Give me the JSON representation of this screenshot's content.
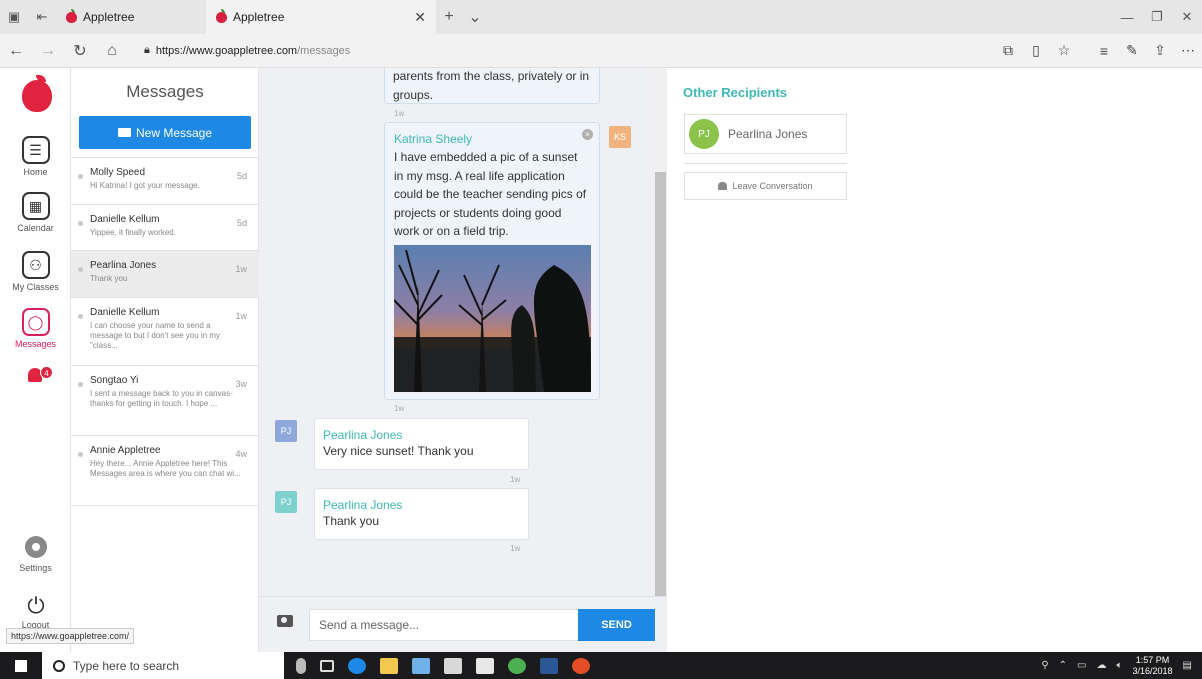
{
  "browser": {
    "tab1_title": "Appletree",
    "tab2_title": "Appletree",
    "url_host": "https://www.goappletree.com",
    "url_path": "/messages"
  },
  "rail": {
    "home": "Home",
    "calendar": "Calendar",
    "classes": "My Classes",
    "messages": "Messages",
    "notif_count": "4",
    "settings": "Settings",
    "logout": "Logout"
  },
  "messages_panel": {
    "title": "Messages",
    "new_message_label": "New Message",
    "conversations": [
      {
        "name": "Molly Speed",
        "time": "5d",
        "preview": "Hi Katrina! I got your message."
      },
      {
        "name": "Danielle Kellum",
        "time": "5d",
        "preview": "Yippee, it finally worked."
      },
      {
        "name": "Pearlina Jones",
        "time": "1w",
        "preview": "Thank you"
      },
      {
        "name": "Danielle Kellum",
        "time": "1w",
        "preview": "I can choose your name to send a message to but I don't see you in my \"class..."
      },
      {
        "name": "Songtao Yi",
        "time": "3w",
        "preview": "I sent a message back to you in canvas- thanks for getting in touch. I hope ..."
      },
      {
        "name": "Annie Appletree",
        "time": "4w",
        "preview": "Hey there... Annie Appletree here! This Messages area is where you can chat wi..."
      }
    ]
  },
  "thread": {
    "top_fragment": "parents from the class, privately or in groups.",
    "top_time": "1w",
    "msg1": {
      "sender": "Katrina Sheely",
      "initials": "KS",
      "body": "I have embedded a pic of a sunset in my msg. A real life application could be the teacher sending pics of projects or students doing good work or on a field trip.",
      "time": "1w"
    },
    "msg2": {
      "sender": "Pearlina Jones",
      "initials": "PJ",
      "body": "Very nice sunset! Thank you",
      "time": "1w"
    },
    "msg3": {
      "sender": "Pearlina Jones",
      "initials": "PJ",
      "body": "Thank you",
      "time": "1w"
    }
  },
  "composer": {
    "placeholder": "Send a message...",
    "send_label": "SEND"
  },
  "recipients": {
    "title": "Other Recipients",
    "name": "Pearlina Jones",
    "initials": "PJ",
    "leave_label": "Leave Conversation"
  },
  "status_url": "https://www.goappletree.com/",
  "taskbar": {
    "search_placeholder": "Type here to search",
    "time": "1:57 PM",
    "date": "3/16/2018"
  },
  "colors": {
    "accent_blue": "#1e88e5",
    "teal": "#3eb8b3",
    "brand_red": "#e0233f",
    "messages_pink": "#d9215a"
  }
}
